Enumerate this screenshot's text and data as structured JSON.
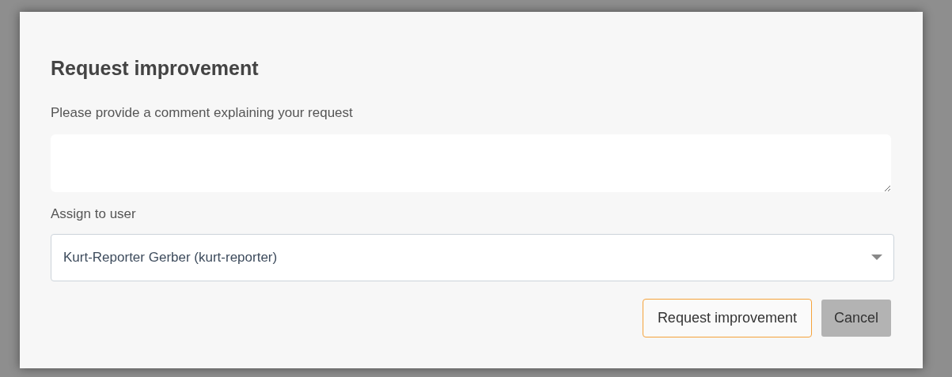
{
  "dialog": {
    "title": "Request improvement",
    "comment": {
      "label": "Please provide a comment explaining your request"
    },
    "assignee": {
      "label": "Assign to user",
      "value": "Kurt-Reporter Gerber (kurt-reporter)"
    },
    "buttons": [
      {
        "label": "Request improvement",
        "kind": "primary"
      },
      {
        "label": "Cancel",
        "kind": "secondary"
      }
    ]
  }
}
